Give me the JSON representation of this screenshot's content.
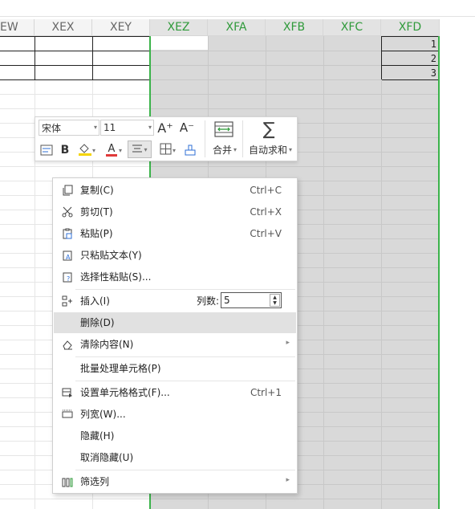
{
  "columns": [
    "EW",
    "XEX",
    "XEY",
    "XEZ",
    "XFA",
    "XFB",
    "XFC",
    "XFD"
  ],
  "selected_columns": [
    "XEZ",
    "XFA",
    "XFB",
    "XFC",
    "XFD"
  ],
  "row_numbers": [
    "1",
    "2",
    "3"
  ],
  "mini_toolbar": {
    "font_name": "宋体",
    "font_size": "11",
    "increase_font_icon": "A⁺",
    "decrease_font_icon": "A⁻",
    "bold_label": "B",
    "font_color_icon": "A",
    "merge_label": "合并",
    "autosum_label": "自动求和",
    "sigma_icon": "∑",
    "accent_red": "#e03a3a",
    "fill_yellow": "#f5d400"
  },
  "context_menu": {
    "copy": {
      "label": "复制(C)",
      "shortcut": "Ctrl+C"
    },
    "cut": {
      "label": "剪切(T)",
      "shortcut": "Ctrl+X"
    },
    "paste": {
      "label": "粘贴(P)",
      "shortcut": "Ctrl+V"
    },
    "paste_text_only": {
      "label": "只粘贴文本(Y)"
    },
    "paste_special": {
      "label": "选择性粘贴(S)..."
    },
    "insert": {
      "label": "插入(I)",
      "cols_label": "列数:",
      "cols_value": "5"
    },
    "delete": {
      "label": "删除(D)"
    },
    "clear": {
      "label": "清除内容(N)"
    },
    "batch": {
      "label": "批量处理单元格(P)"
    },
    "format_cells": {
      "label": "设置单元格格式(F)...",
      "shortcut": "Ctrl+1"
    },
    "col_width": {
      "label": "列宽(W)..."
    },
    "hide": {
      "label": "隐藏(H)"
    },
    "unhide": {
      "label": "取消隐藏(U)"
    },
    "filter": {
      "label": "筛选列"
    }
  },
  "colors": {
    "selection_green": "#3bb34a",
    "selected_header_text": "#2f9a3a",
    "selection_fill": "#d9d9d9"
  }
}
